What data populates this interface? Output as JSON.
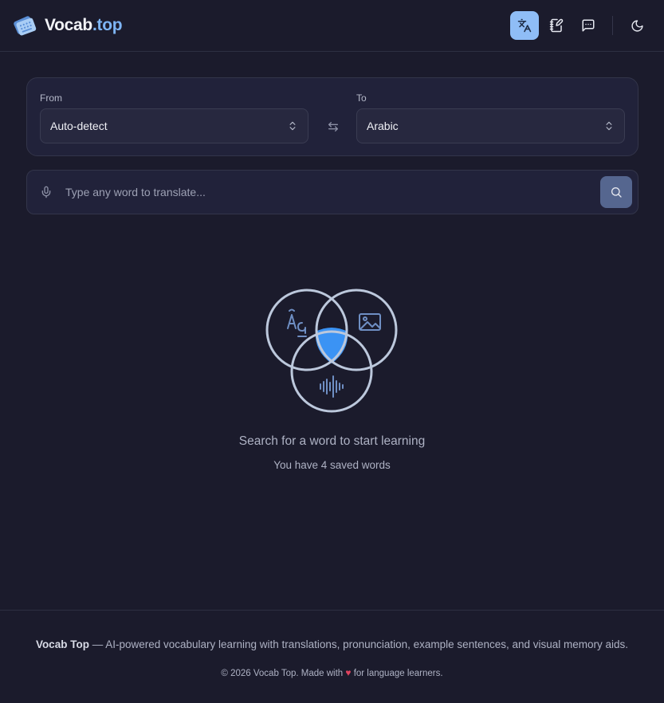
{
  "header": {
    "brand_main": "Vocab",
    "brand_accent": ".top",
    "actions": [
      {
        "name": "translate-icon",
        "active": true
      },
      {
        "name": "edit-note-icon",
        "active": false
      },
      {
        "name": "chat-icon",
        "active": false
      },
      {
        "name": "moon-icon",
        "active": false
      }
    ]
  },
  "language": {
    "from_label": "From",
    "from_value": "Auto-detect",
    "to_label": "To",
    "to_value": "Arabic"
  },
  "search": {
    "placeholder": "Type any word to translate..."
  },
  "empty_state": {
    "title": "Search for a word to start learning",
    "subtitle": "You have 4 saved words"
  },
  "footer": {
    "brand": "Vocab Top",
    "tagline": " — AI-powered vocabulary learning with translations, pronunciation, example sentences, and visual memory aids.",
    "copyright_prefix": "© 2026 Vocab Top. Made with ",
    "copyright_suffix": " for language learners."
  },
  "colors": {
    "background": "#1b1b2c",
    "accent": "#8fbdf6",
    "brand_accent": "#7eb5f5",
    "heart": "#e0435f",
    "venn_center": "#3b93f4"
  }
}
